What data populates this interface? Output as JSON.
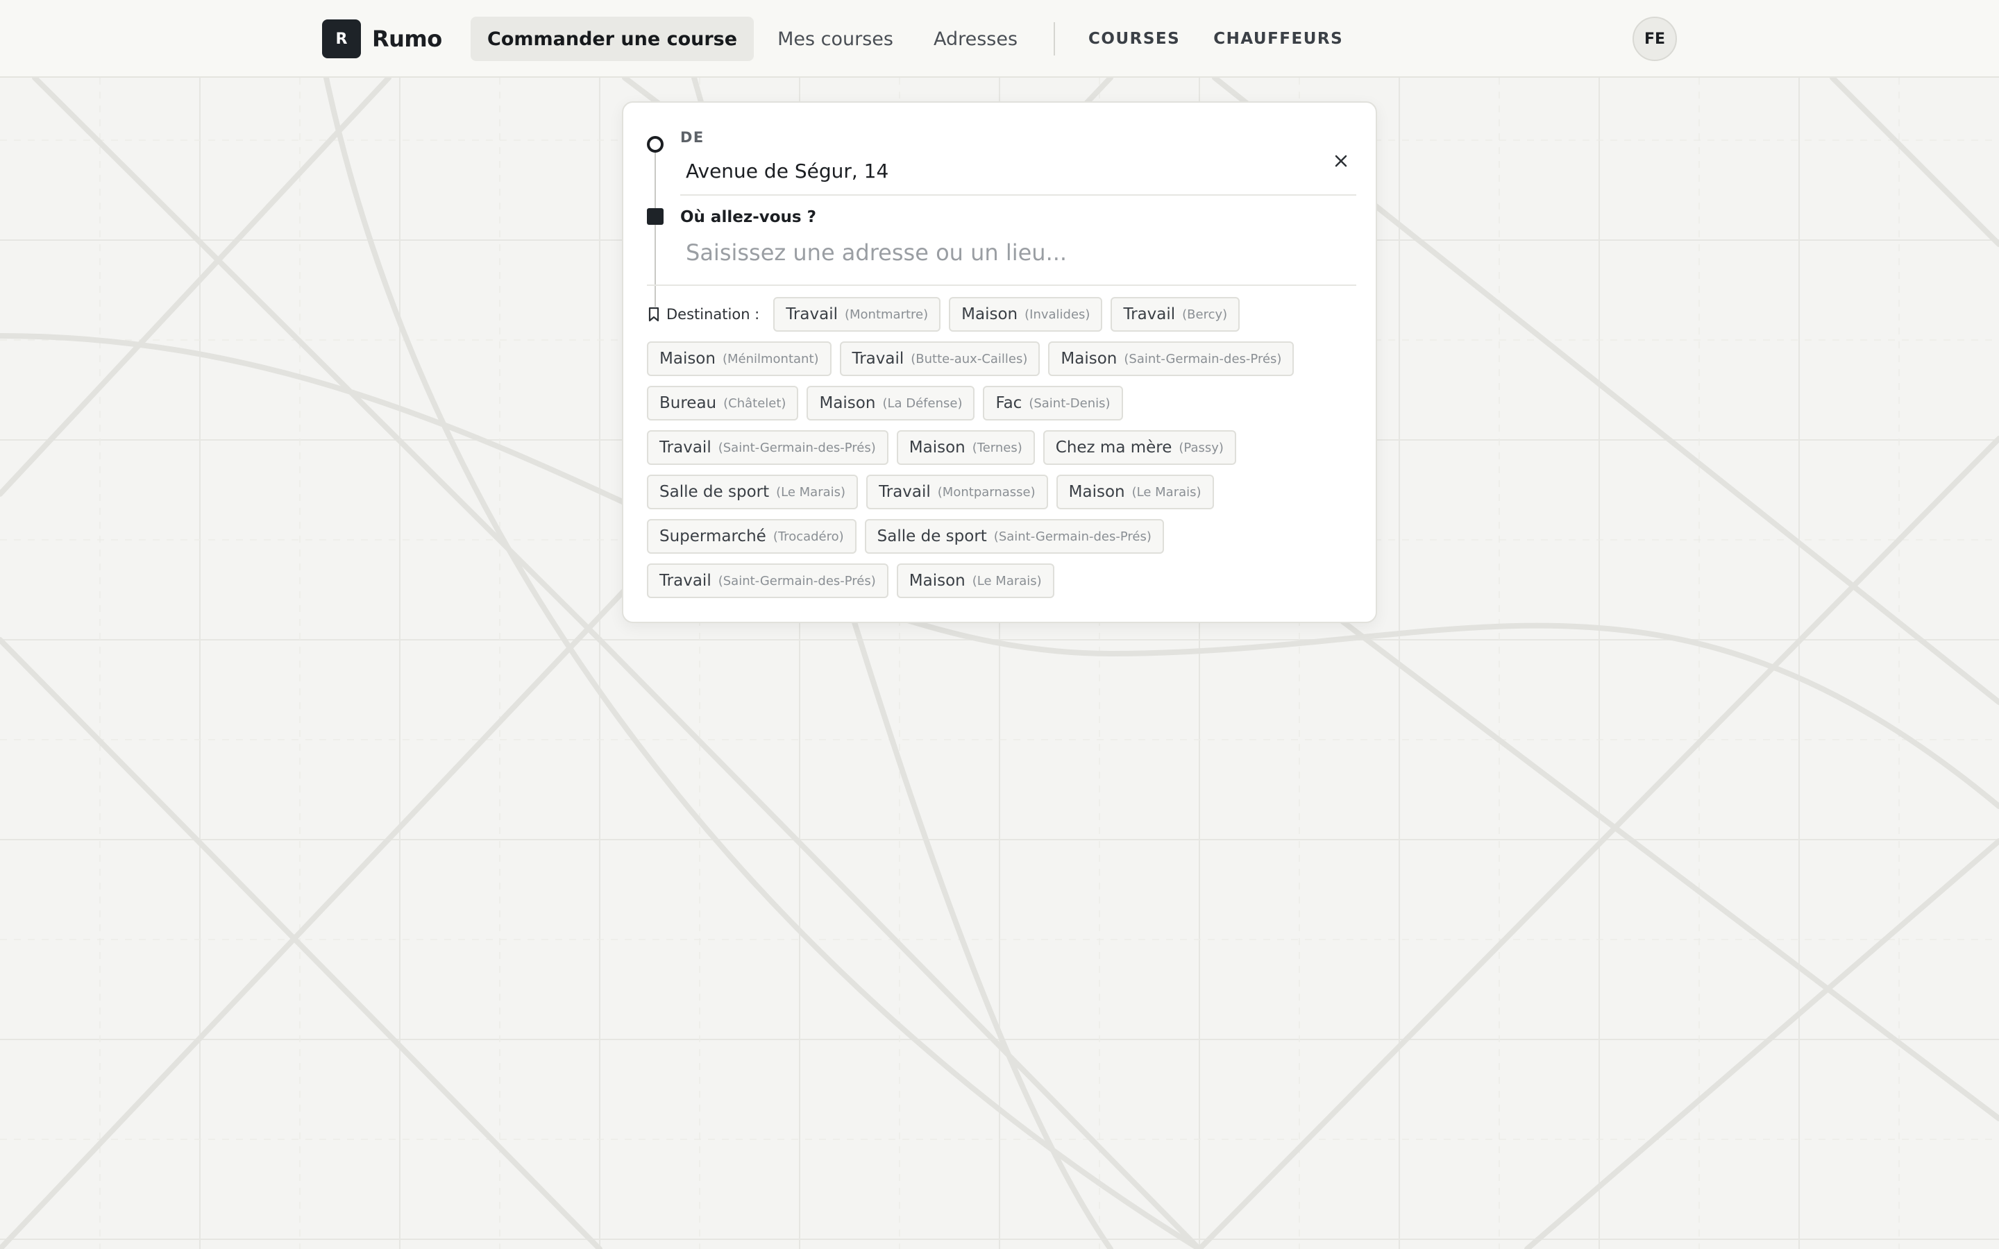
{
  "app": {
    "name": "Rumo",
    "logo_letter": "R"
  },
  "nav": {
    "items": [
      {
        "label": "Commander une course",
        "active": true
      },
      {
        "label": "Mes courses",
        "active": false
      },
      {
        "label": "Adresses",
        "active": false
      }
    ],
    "secondary": [
      {
        "label": "COURSES"
      },
      {
        "label": "CHAUFFEURS"
      }
    ]
  },
  "user": {
    "initials": "FE"
  },
  "booking": {
    "from_label": "DE",
    "from_value": "Avenue de Ségur, 14",
    "to_label": "Où allez-vous ?",
    "to_placeholder": "Saisissez une adresse ou un lieu...",
    "to_value": "",
    "destinations_label": "Destination :",
    "destinations": [
      {
        "name": "Travail",
        "area": "(Montmartre)"
      },
      {
        "name": "Maison",
        "area": "(Invalides)"
      },
      {
        "name": "Travail",
        "area": "(Bercy)"
      },
      {
        "name": "Maison",
        "area": "(Ménilmontant)"
      },
      {
        "name": "Travail",
        "area": "(Butte-aux-Cailles)"
      },
      {
        "name": "Maison",
        "area": "(Saint-Germain-des-Prés)"
      },
      {
        "name": "Bureau",
        "area": "(Châtelet)"
      },
      {
        "name": "Maison",
        "area": "(La Défense)"
      },
      {
        "name": "Fac",
        "area": "(Saint-Denis)"
      },
      {
        "name": "Travail",
        "area": "(Saint-Germain-des-Prés)"
      },
      {
        "name": "Maison",
        "area": "(Ternes)"
      },
      {
        "name": "Chez ma mère",
        "area": "(Passy)"
      },
      {
        "name": "Salle de sport",
        "area": "(Le Marais)"
      },
      {
        "name": "Travail",
        "area": "(Montparnasse)"
      },
      {
        "name": "Maison",
        "area": "(Le Marais)"
      },
      {
        "name": "Supermarché",
        "area": "(Trocadéro)"
      },
      {
        "name": "Salle de sport",
        "area": "(Saint-Germain-des-Prés)"
      },
      {
        "name": "Travail",
        "area": "(Saint-Germain-des-Prés)"
      },
      {
        "name": "Maison",
        "area": "(Le Marais)"
      }
    ]
  },
  "colors": {
    "accent": "#1e2328",
    "background": "#f4f4f2",
    "map_lines": "#e2e2de"
  },
  "icons": {
    "close": "close-icon",
    "bookmark": "bookmark-icon"
  }
}
